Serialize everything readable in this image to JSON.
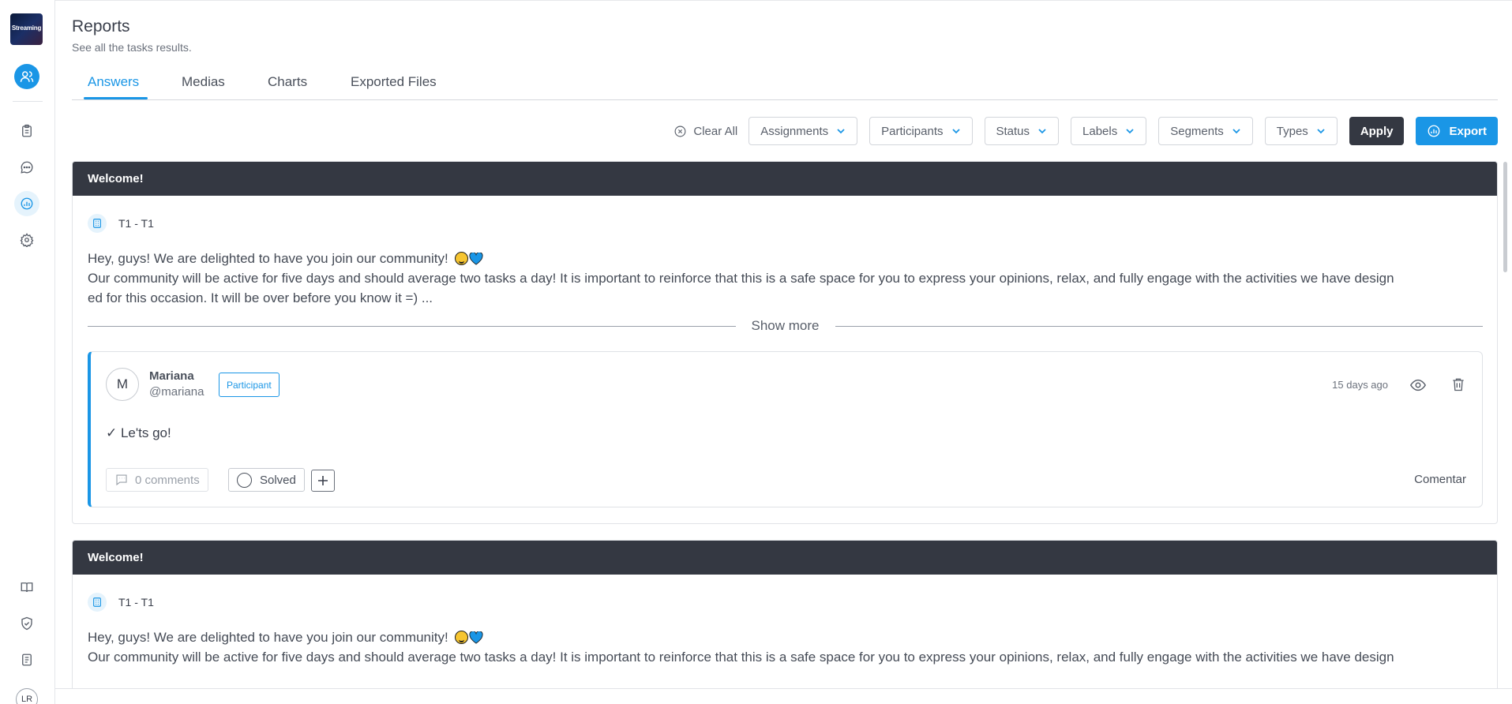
{
  "app": {
    "logo_text": "Streaming"
  },
  "sidebar": {
    "user_initials": "LR",
    "items": [
      {
        "icon": "users-icon"
      },
      {
        "icon": "clipboard-icon"
      },
      {
        "icon": "chat-icon"
      },
      {
        "icon": "chart-icon",
        "active": true
      },
      {
        "icon": "gear-icon"
      },
      {
        "icon": "book-icon"
      },
      {
        "icon": "shield-check-icon"
      },
      {
        "icon": "document-icon"
      }
    ]
  },
  "header": {
    "title": "Reports",
    "subtitle": "See all the tasks results."
  },
  "tabs": [
    {
      "label": "Answers",
      "active": true
    },
    {
      "label": "Medias"
    },
    {
      "label": "Charts"
    },
    {
      "label": "Exported Files"
    }
  ],
  "filters": {
    "clear_all": "Clear All",
    "dropdowns": [
      "Assignments",
      "Participants",
      "Status",
      "Labels",
      "Segments",
      "Types"
    ],
    "apply": "Apply",
    "export": "Export"
  },
  "cards": [
    {
      "title": "Welcome!",
      "task": "T1 - T1",
      "line1": "Hey, guys! We are delighted to have you join our community!",
      "line2": "Our community will be active for five days and should average two tasks a day! It is important to reinforce that this is a safe space for you to express your opinions, relax, and fully engage with the activities we have design",
      "line3": "ed for this occasion. It will be over before you know it =)  ...",
      "show_more": "Show more",
      "answer": {
        "initial": "M",
        "name": "Mariana",
        "handle": "@mariana",
        "role": "Participant",
        "time": "15 days ago",
        "text": "✓  Le'ts go!",
        "comments": "0 comments",
        "solved": "Solved",
        "comment_action": "Comentar"
      }
    },
    {
      "title": "Welcome!",
      "task": "T1 - T1",
      "line1": "Hey, guys! We are delighted to have you join our community!",
      "line2": "Our community will be active for five days and should average two tasks a day! It is important to reinforce that this is a safe space for you to express your opinions, relax, and fully engage with the activities we have design"
    }
  ],
  "colors": {
    "accent": "#1a96e6",
    "dark": "#343842",
    "border": "#e1e3e7"
  }
}
